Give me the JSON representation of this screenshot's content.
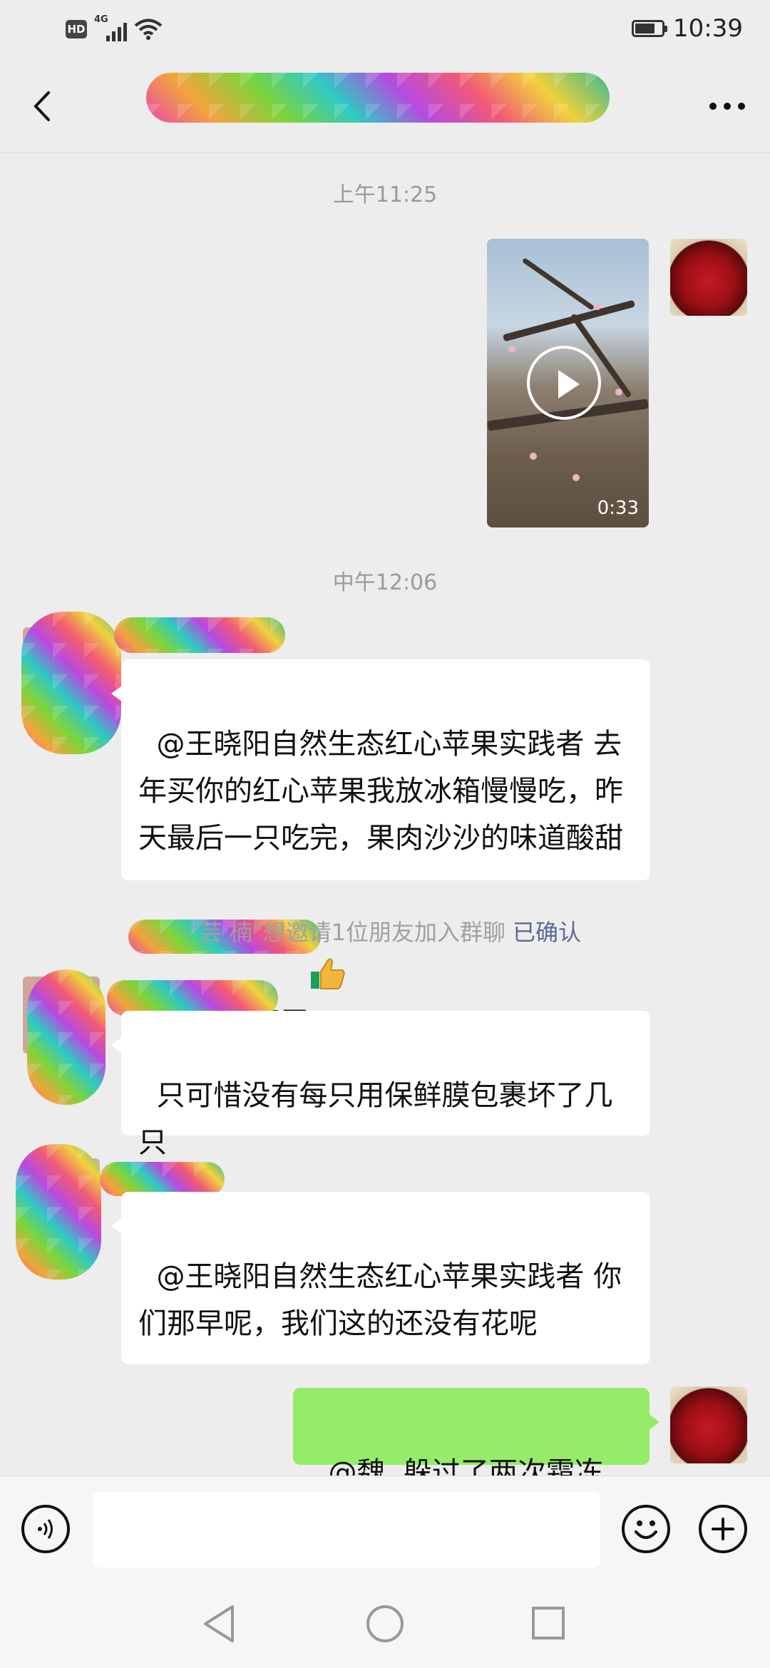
{
  "status_bar": {
    "network_badge": "HD",
    "network_type": "4G",
    "time": "10:39",
    "battery_percent": 68
  },
  "header": {
    "title": "[redacted group name]",
    "back_icon": "chevron-left-icon",
    "more_icon": "more-horizontal-icon"
  },
  "chat": {
    "timestamps": [
      "上午11:25",
      "中午12:06"
    ],
    "video_message": {
      "duration": "0:33",
      "thumbnail": "peach blossom orchard"
    },
    "messages": [
      {
        "side": "left",
        "text": "@王晓阳自然生态红心苹果实践者 去年买你的红心苹果我放冰箱慢慢吃，昨天最后一只吃完，果肉沙沙的味道酸甜比以前柔和了",
        "emoji": "thumbs-up-icon"
      },
      {
        "side": "left",
        "text": "只可惜没有每只用保鲜膜包裹坏了几只"
      },
      {
        "side": "left",
        "text": "@王晓阳自然生态红心苹果实践者 你们那早呢，我们这的还没有花呢"
      },
      {
        "side": "right",
        "text": "@魏  躲过了两次霜冻"
      }
    ],
    "system_message": {
      "text": "\"芸 楠\"想邀请1位朋友加入群聊",
      "link": "已确认"
    }
  },
  "input_bar": {
    "voice_icon": "voice-icon",
    "emoji_icon": "emoji-icon",
    "plus_icon": "plus-icon",
    "text_value": ""
  },
  "system_nav": {
    "back": "nav-back-icon",
    "home": "nav-home-icon",
    "recents": "nav-recents-icon"
  }
}
